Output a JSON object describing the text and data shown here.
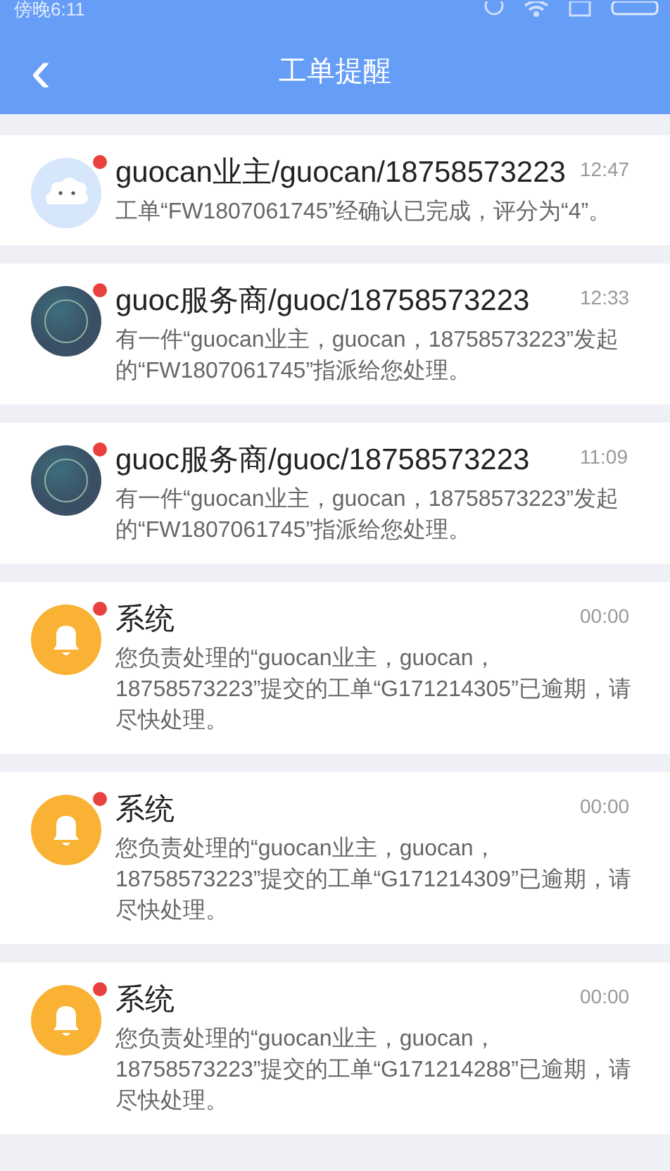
{
  "status_bar": {
    "time": "傍晚6:11"
  },
  "header": {
    "back": "‹",
    "title": "工单提醒"
  },
  "messages": [
    {
      "kind": "cloud",
      "unread": true,
      "title": "guocan业主/guocan/18758573223",
      "time": "12:47",
      "body": "工单“FW1807061745”经确认已完成，评分为“4”。"
    },
    {
      "kind": "orb",
      "unread": true,
      "title": "guoc服务商/guoc/18758573223",
      "time": "12:33",
      "body": "有一件“guocan业主，guocan，18758573223”发起的“FW1807061745”指派给您处理。"
    },
    {
      "kind": "orb",
      "unread": true,
      "title": "guoc服务商/guoc/18758573223",
      "time": "11:09",
      "body": "有一件“guocan业主，guocan，18758573223”发起的“FW1807061745”指派给您处理。"
    },
    {
      "kind": "bell",
      "unread": true,
      "title": "系统",
      "time": "00:00",
      "body": "您负责处理的“guocan业主，guocan，18758573223”提交的工单“G171214305”已逾期，请尽快处理。"
    },
    {
      "kind": "bell",
      "unread": true,
      "title": "系统",
      "time": "00:00",
      "body": "您负责处理的“guocan业主，guocan，18758573223”提交的工单“G171214309”已逾期，请尽快处理。"
    },
    {
      "kind": "bell",
      "unread": true,
      "title": "系统",
      "time": "00:00",
      "body": "您负责处理的“guocan业主，guocan，18758573223”提交的工单“G171214288”已逾期，请尽快处理。"
    }
  ]
}
